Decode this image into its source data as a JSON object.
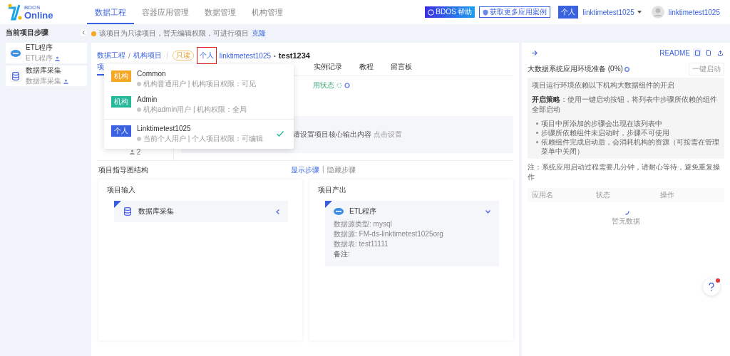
{
  "nav": {
    "logo_small": "BDOS",
    "logo_big": "Online",
    "menu": [
      {
        "label": "数据工程",
        "selected": true
      },
      {
        "label": "容器应用管理",
        "selected": false
      },
      {
        "label": "数据管理",
        "selected": false
      },
      {
        "label": "机构管理",
        "selected": false
      }
    ],
    "help_button": "BDOS 帮助",
    "cases_button": "获取更多应用案例",
    "account_badge": "个人",
    "account_name": "linktimetest1025",
    "user": "linktimetest1025"
  },
  "sidebar": {
    "title": "当前项目步骤",
    "items": [
      {
        "kind": "etl",
        "title": "ETL程序",
        "subtitle": "ETL程序"
      },
      {
        "kind": "db",
        "title": "数据库采集",
        "subtitle": "数据库采集"
      }
    ]
  },
  "notice": {
    "text": "该项目为只读项目，暂无编辑权限，可进行项目",
    "link": "克隆"
  },
  "breadcrumb": {
    "items": [
      "数据工程",
      "机构项目"
    ],
    "separator": "/",
    "readonly_tag": "只读",
    "scope": "个人",
    "scope_highlighted": true,
    "owner": "linktimetest1025",
    "dot": "•",
    "project": "test1234"
  },
  "tabs": [
    {
      "label": "项",
      "selected": true
    },
    {
      "label": "实例记录",
      "selected": false
    },
    {
      "label": "教程",
      "selected": false
    },
    {
      "label": "留言板",
      "selected": false
    }
  ],
  "status_text": "用状态",
  "member_count": "2",
  "output_placeholder": {
    "text": "请设置项目核心输出内容",
    "link": "点击设置"
  },
  "guide": {
    "title": "项目指导图结构",
    "separator": "|",
    "links": [
      {
        "label": "显示步骤",
        "selected": true
      },
      {
        "label": "隐藏步骤",
        "selected": false
      }
    ]
  },
  "panels": [
    {
      "title": "项目输入",
      "items": [
        {
          "kind": "db",
          "name": "数据库采集",
          "expanded": false
        }
      ]
    },
    {
      "title": "项目产出",
      "items": [
        {
          "kind": "etl",
          "name": "ETL程序",
          "expanded": true,
          "details": [
            "数据源类型: mysql",
            "数据源: FM-ds-linktimetest1025org",
            "数据表: test11111",
            "备注:"
          ]
        }
      ]
    }
  ],
  "right": {
    "readme": "README",
    "title": "大数据系统应用环境准备 (0%)",
    "start_button": {
      "label": "一键启动",
      "disabled": true
    },
    "intro": "项目运行环境依赖以下机构大数据组件的开启",
    "strategy": "**开启策略**：使用一键启动按钮，将列表中步骤所依赖的组件全部启动",
    "bullets": [
      "项目中所添加的步骤会出现在该列表中",
      "步骤所依赖组件未启动时，步骤不可使用",
      "依赖组件完成启动后，会消耗机构的资源（可按需在管理菜单中关闭）"
    ],
    "note": "注：系统应用启动过程需要几分钟，请耐心等待，避免重复操作",
    "columns": [
      "应用名",
      "状态",
      "操作"
    ],
    "empty": "暂无数据"
  },
  "dropdown": {
    "items": [
      {
        "kind": "org",
        "tag": "机构",
        "color": "#f5a623",
        "name": "Common",
        "desc": "机构普通用户 | 机构项目权限：可见",
        "selected": false
      },
      {
        "kind": "org",
        "tag": "机构",
        "color": "#26b89a",
        "name": "Admin",
        "desc": "机构admin用户 | 机构权限：全局",
        "selected": false
      },
      {
        "kind": "personal",
        "tag": "个人",
        "color": "#3a62e0",
        "name": "Linktimetest1025",
        "desc": "当前个人用户 | 个人项目权限：可编辑",
        "selected": true
      }
    ]
  }
}
